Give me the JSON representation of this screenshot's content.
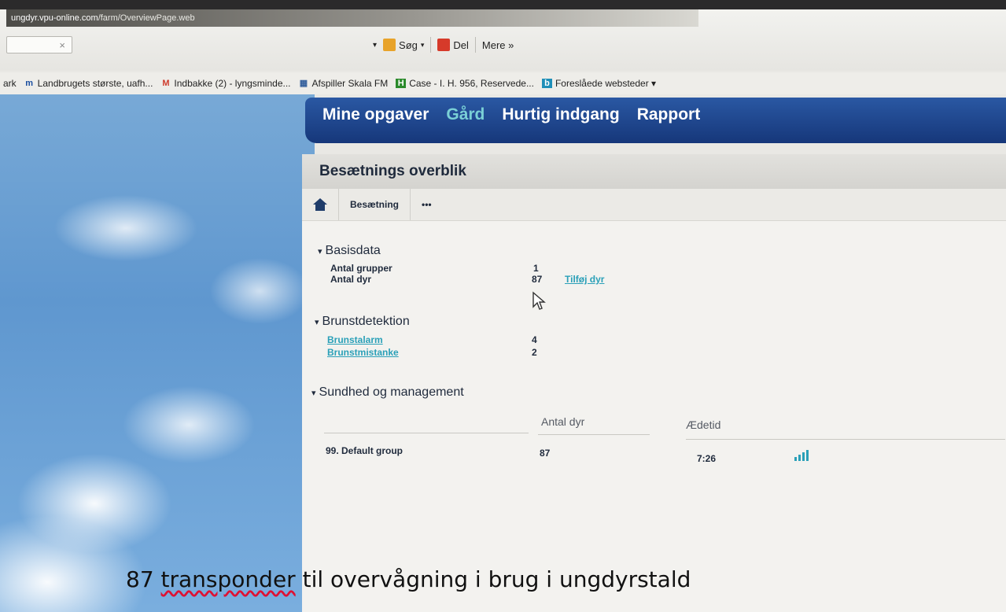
{
  "browser": {
    "url_host": "ungdyr.vpu-online.com",
    "url_path": "/farm/OverviewPage.web",
    "tab_close": "×",
    "toolbar": [
      {
        "label": "Søg",
        "icon": "search-icon",
        "color": "#e8a32a"
      },
      {
        "label": "Del",
        "icon": "share-icon",
        "color": "#d63a2a"
      },
      {
        "label": "Mere »",
        "icon": "",
        "color": ""
      }
    ],
    "favorites": [
      {
        "label": "ark",
        "icon": ""
      },
      {
        "label": "Landbrugets største, uafh...",
        "icon": "landbrug-icon",
        "glyph": "m",
        "color": "#1c4fa0"
      },
      {
        "label": "Indbakke (2) - lyngsminde...",
        "icon": "gmail-icon",
        "glyph": "M",
        "color": "#cf3b2c"
      },
      {
        "label": "Afspiller Skala FM",
        "icon": "radio-icon",
        "glyph": "▦",
        "color": "#335f9c"
      },
      {
        "label": "Case - I. H. 956, Reservede...",
        "icon": "case-icon",
        "glyph": "H",
        "color": "#2b8a2b"
      },
      {
        "label": "Foreslåede websteder ▾",
        "icon": "bing-icon",
        "glyph": "b",
        "color": "#1f8fb8"
      }
    ]
  },
  "nav": {
    "items": [
      "Mine opgaver",
      "Gård",
      "Hurtig indgang",
      "Rapport"
    ],
    "active_index": 1
  },
  "panel": {
    "title": "Besætnings overblik",
    "breadcrumb": [
      "Besætning",
      "•••"
    ]
  },
  "basisdata": {
    "title": "Basisdata",
    "rows": [
      {
        "label": "Antal grupper",
        "value": "1"
      },
      {
        "label": "Antal dyr",
        "value": "87",
        "action": "Tilføj dyr"
      }
    ]
  },
  "brunst": {
    "title": "Brunstdetektion",
    "rows": [
      {
        "label": "Brunstalarm",
        "value": "4"
      },
      {
        "label": "Brunstmistanke",
        "value": "2"
      }
    ]
  },
  "sundhed": {
    "title": "Sundhed og management",
    "columns": [
      "Antal dyr",
      "Ædetid"
    ],
    "rows": [
      {
        "group": "99. Default group",
        "antal": "87",
        "aedetid": "7:26"
      }
    ]
  },
  "caption": {
    "word1": "87 ",
    "spell": "transponder",
    "rest": " til overvågning i brug i ungdyrstald"
  }
}
